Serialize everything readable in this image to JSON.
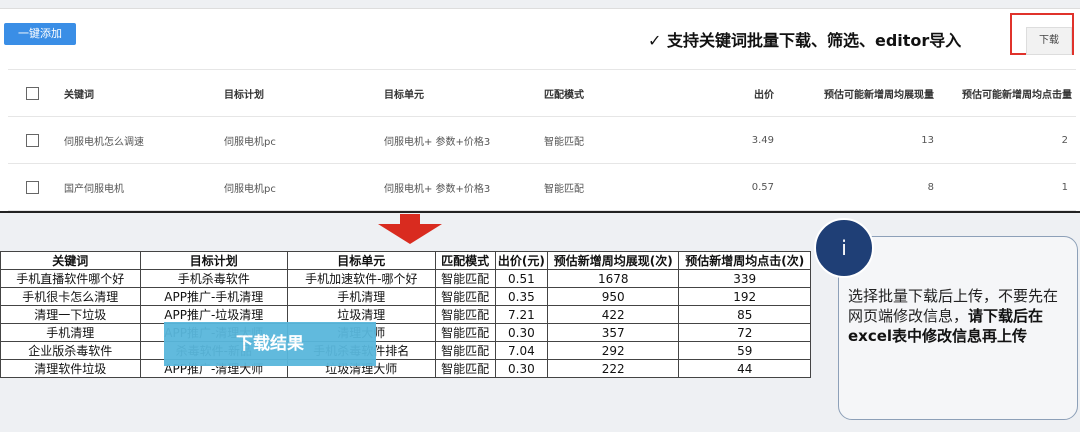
{
  "top": {
    "add_button": "一键添加",
    "note": "✓ 支持关键词批量下载、筛选、editor导入",
    "download_button": "下载",
    "headers": [
      "关键词",
      "目标计划",
      "目标单元",
      "匹配模式",
      "出价",
      "预估可能新增周均展现量",
      "预估可能新增周均点击量"
    ],
    "rows": [
      [
        "伺服电机怎么调速",
        "伺服电机pc",
        "伺服电机+ 参数+价格3",
        "智能匹配",
        "3.49",
        "13",
        "2"
      ],
      [
        "国产伺服电机",
        "伺服电机pc",
        "伺服电机+ 参数+价格3",
        "智能匹配",
        "0.57",
        "8",
        "1"
      ]
    ]
  },
  "result": {
    "headers": [
      "关键词",
      "目标计划",
      "目标单元",
      "匹配模式",
      "出价(元)",
      "预估新增周均展现(次)",
      "预估新增周均点击(次)"
    ],
    "rows": [
      [
        "手机直播软件哪个好",
        "手机杀毒软件",
        "手机加速软件-哪个好",
        "智能匹配",
        "0.51",
        "1678",
        "339"
      ],
      [
        "手机很卡怎么清理",
        "APP推广-手机清理",
        "手机清理",
        "智能匹配",
        "0.35",
        "950",
        "192"
      ],
      [
        "清理一下垃圾",
        "APP推广-垃圾清理",
        "垃圾清理",
        "智能匹配",
        "7.21",
        "422",
        "85"
      ],
      [
        "手机清理",
        "APP推广-清理大师",
        "清理大师",
        "智能匹配",
        "0.30",
        "357",
        "72"
      ],
      [
        "企业版杀毒软件",
        "杀毒软件-新品",
        "手机杀毒软件排名",
        "智能匹配",
        "7.04",
        "292",
        "59"
      ],
      [
        "清理软件垃圾",
        "APP推广-清理大师",
        "垃圾清理大师",
        "智能匹配",
        "0.30",
        "222",
        "44"
      ]
    ],
    "banner": "下载结果"
  },
  "info": {
    "icon": "i",
    "text_normal": "选择批量下载后上传，不要先在网页端修改信息，",
    "text_bold": "请下载后在excel表中修改信息再上传"
  }
}
